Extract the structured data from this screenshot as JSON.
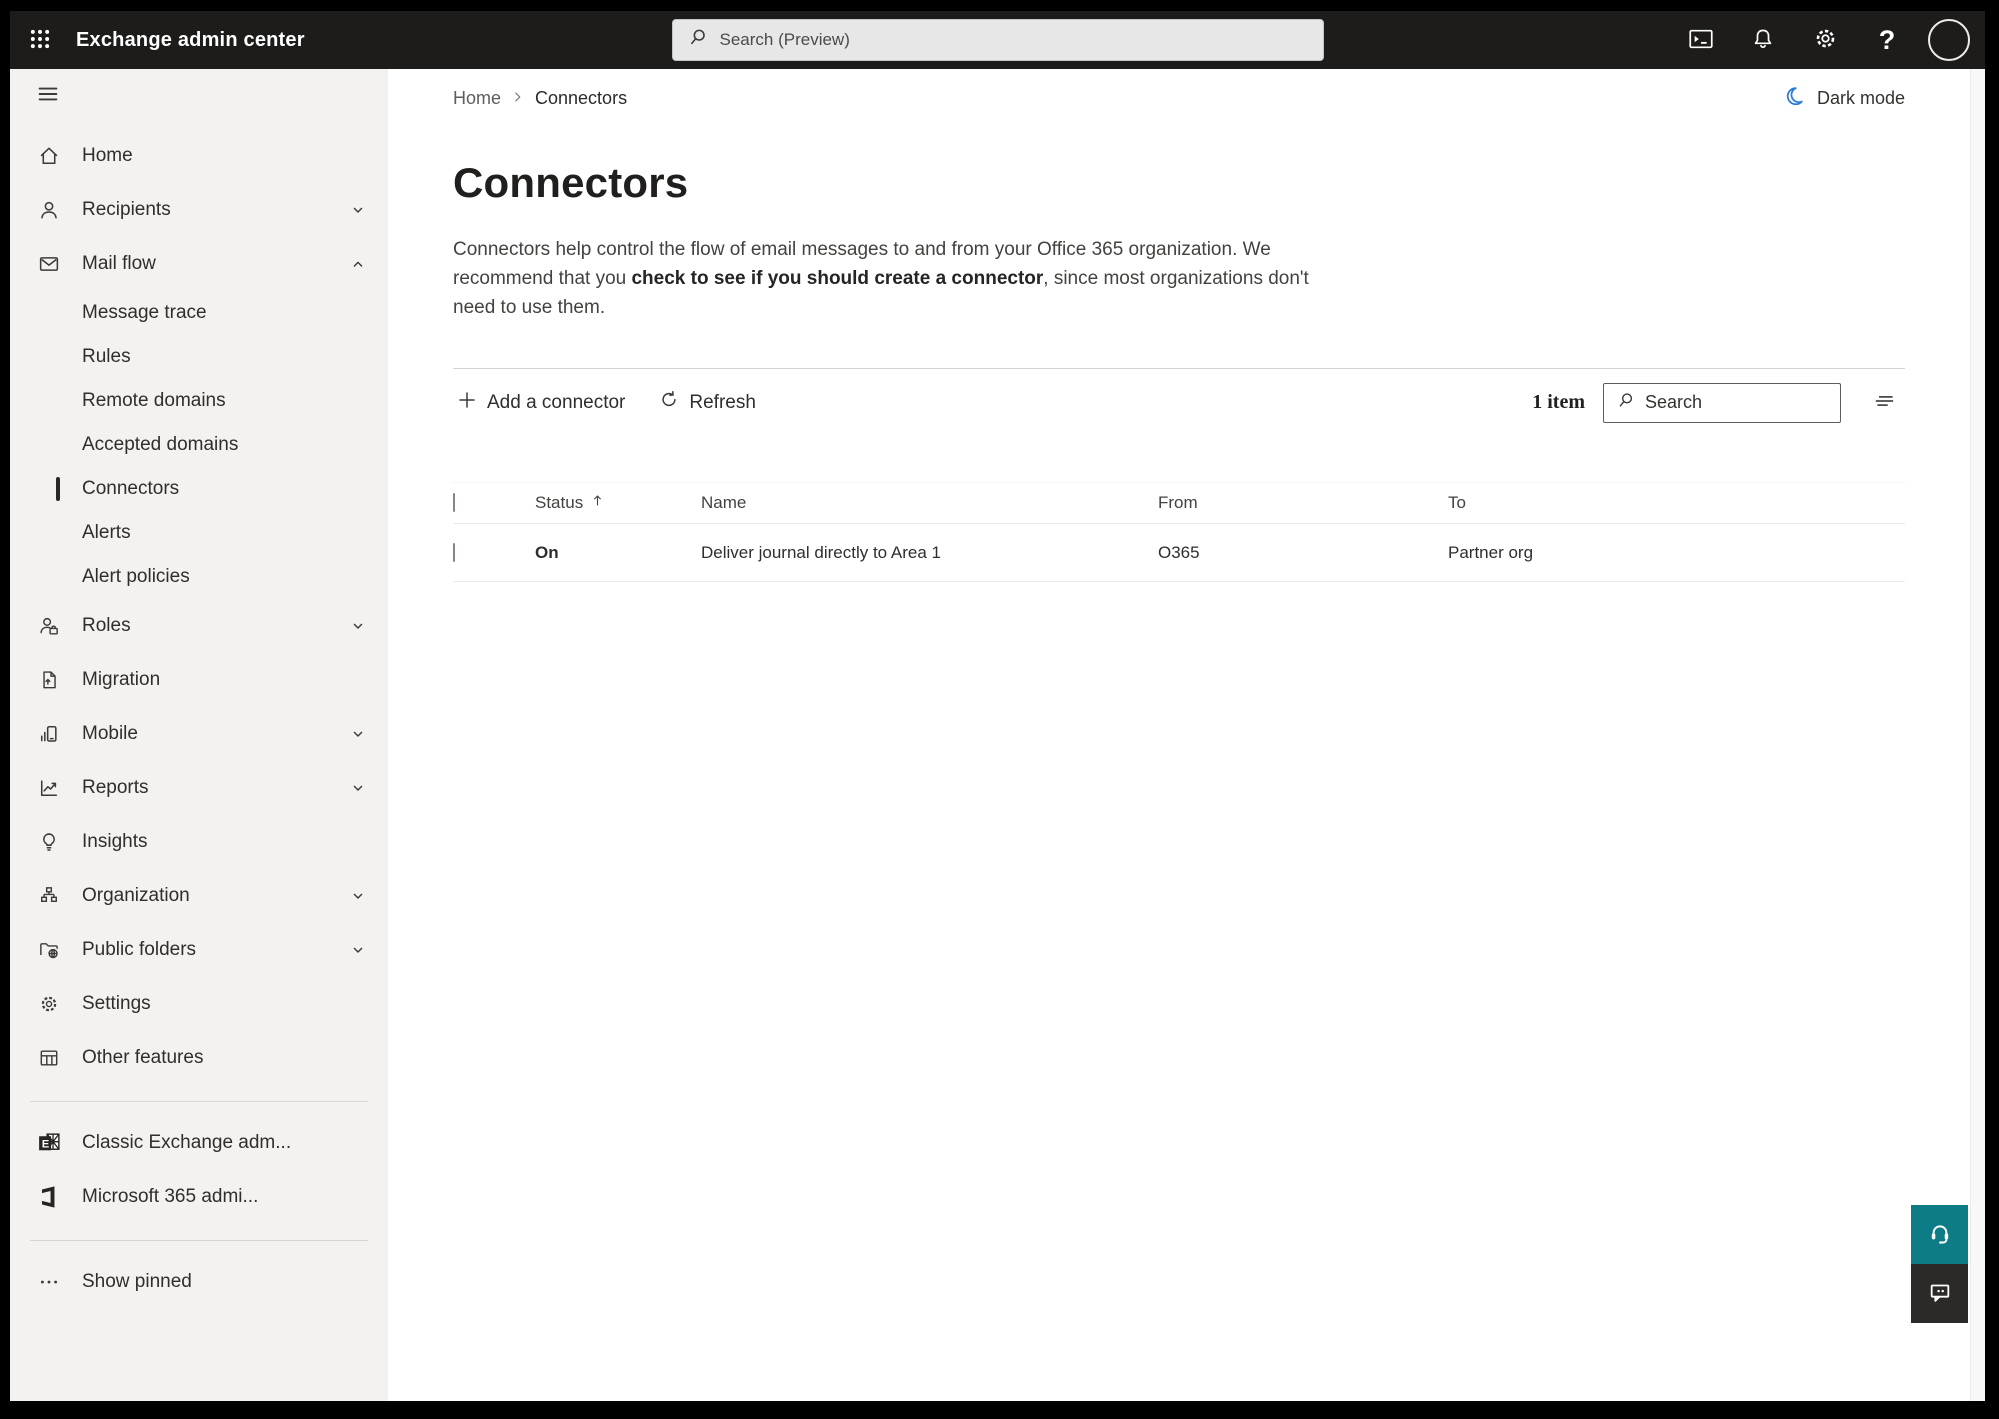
{
  "topbar": {
    "title": "Exchange admin center",
    "search_placeholder": "Search (Preview)"
  },
  "breadcrumb": {
    "home": "Home",
    "current": "Connectors"
  },
  "header_actions": {
    "dark_mode": "Dark mode"
  },
  "page": {
    "title": "Connectors",
    "desc_pre": "Connectors help control the flow of email messages to and from your Office 365 organization. We recommend that you ",
    "desc_bold": "check to see if you should create a connector",
    "desc_post": ", since most organizations don't need to use them."
  },
  "toolbar": {
    "add": "Add a connector",
    "refresh": "Refresh",
    "count": "1 item",
    "search_placeholder": "Search"
  },
  "table": {
    "headers": {
      "status": "Status",
      "name": "Name",
      "from": "From",
      "to": "To"
    },
    "rows": [
      {
        "status": "On",
        "name": "Deliver journal directly to Area 1",
        "from": "O365",
        "to": "Partner org"
      }
    ]
  },
  "sidebar": {
    "main": [
      {
        "label": "Home"
      },
      {
        "label": "Recipients"
      },
      {
        "label": "Mail flow"
      },
      {
        "label": "Roles"
      },
      {
        "label": "Migration"
      },
      {
        "label": "Mobile"
      },
      {
        "label": "Reports"
      },
      {
        "label": "Insights"
      },
      {
        "label": "Organization"
      },
      {
        "label": "Public folders"
      },
      {
        "label": "Settings"
      },
      {
        "label": "Other features"
      }
    ],
    "mailflow_children": [
      "Message trace",
      "Rules",
      "Remote domains",
      "Accepted domains",
      "Connectors",
      "Alerts",
      "Alert policies"
    ],
    "footer": [
      "Classic Exchange adm...",
      "Microsoft 365 admi..."
    ],
    "show_pinned": "Show pinned"
  },
  "colors": {
    "accent_teal": "#0e7c86",
    "moon_blue": "#2c7cd6",
    "topbar_bg": "#1d1c1b",
    "sidebar_bg": "#f3f2f1"
  }
}
